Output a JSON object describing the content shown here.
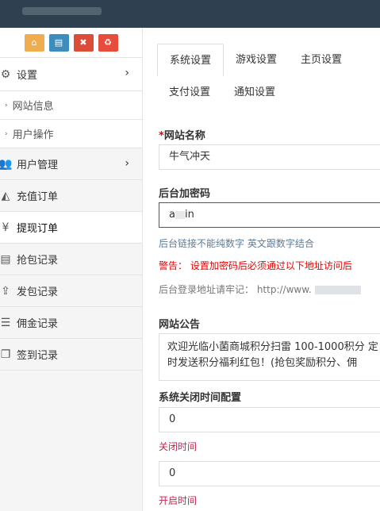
{
  "sidebar": {
    "shortcuts": [
      {
        "name": "home-icon",
        "glyph": "⌂",
        "color": "#f0ad4e"
      },
      {
        "name": "file-icon",
        "glyph": "▤",
        "color": "#3c8dbc"
      },
      {
        "name": "trash-icon",
        "glyph": "🗑",
        "color": "#dd4b39"
      },
      {
        "name": "recycle-icon",
        "glyph": "♻",
        "color": "#e74c3c"
      }
    ],
    "settings_label": "设置",
    "sub_items": [
      "网站信息",
      "用户操作"
    ],
    "items": [
      "用户管理",
      "充值订单",
      "提现订单",
      "抢包记录",
      "发包记录",
      "佣金记录",
      "签到记录"
    ]
  },
  "tabs": [
    "系统设置",
    "游戏设置",
    "主页设置",
    "支付设置",
    "通知设置"
  ],
  "form": {
    "site_name_label": "网站名称",
    "site_name_value": "牛气冲天",
    "backend_code_label": "后台加密码",
    "backend_code_value_start": "a",
    "backend_code_value_end": "in",
    "backend_hint": "后台链接不能纯数字 英文跟数字结合",
    "warning": "警告： 设置加密码后必须通过以下地址访问后",
    "login_url_text": "后台登录地址请牢记： http://www.",
    "announcement_label": "网站公告",
    "announcement_text": "欢迎光临小菌商城积分扫雷 100-1000积分 定时发送积分福利红包！(抢包奖励积分、佣",
    "close_time_label": "系统关闭时间配置",
    "close_time_value": "0",
    "close_time_sub": "关闭时间",
    "open_time_value": "0",
    "open_time_sub": "开启时间"
  }
}
